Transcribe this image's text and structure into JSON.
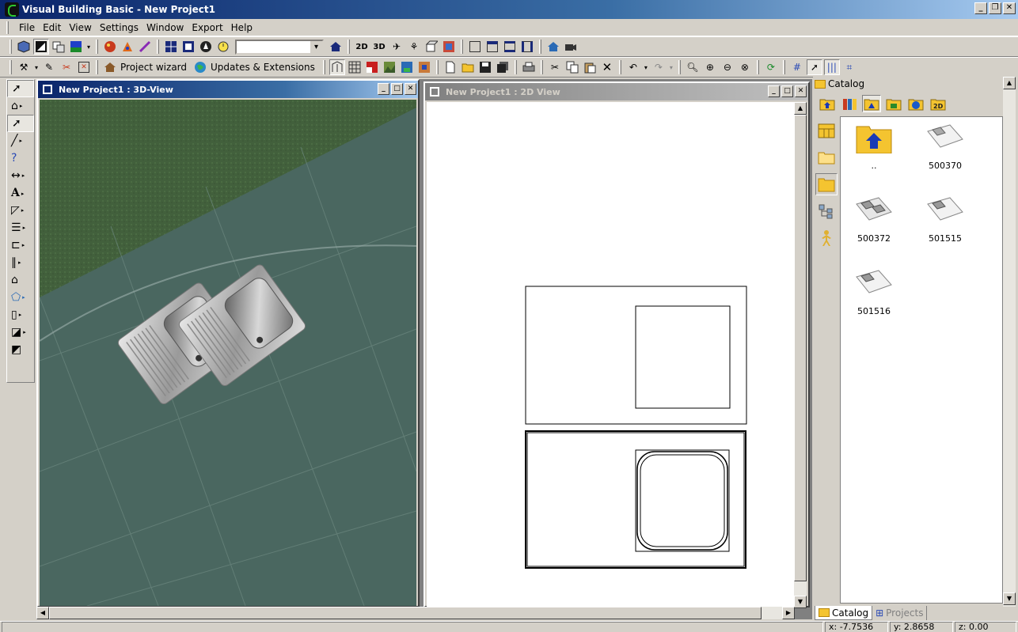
{
  "app": {
    "title": "Visual Building Basic - New Project1",
    "window_controls": [
      "_",
      "❐",
      "✕"
    ]
  },
  "menu": [
    "File",
    "Edit",
    "View",
    "Settings",
    "Window",
    "Export",
    "Help"
  ],
  "toolbar2": {
    "project_wizard": "Project wizard",
    "updates": "Updates & Extensions"
  },
  "view3d": {
    "title": "New Project1 : 3D-View"
  },
  "view2d": {
    "title": "New Project1 : 2D View"
  },
  "catalog": {
    "title": "Catalog",
    "tools": [
      "▲",
      "▮▮",
      "◣",
      "≡",
      "●",
      "2D"
    ],
    "items": [
      {
        "label": ".."
      },
      {
        "label": "500370"
      },
      {
        "label": "500372"
      },
      {
        "label": "501515"
      },
      {
        "label": "501516"
      }
    ],
    "tabs": {
      "catalog": "Catalog",
      "projects": "Projects"
    }
  },
  "status": {
    "x": "x: -7.7536",
    "y": "y: 2.8658",
    "z": "z: 0.00"
  },
  "colors": {
    "title_active": "#0a246a",
    "floor_dark": "#4a6760",
    "terrain_green": "#3f5a3a",
    "folder_yellow": "#f4c430"
  }
}
